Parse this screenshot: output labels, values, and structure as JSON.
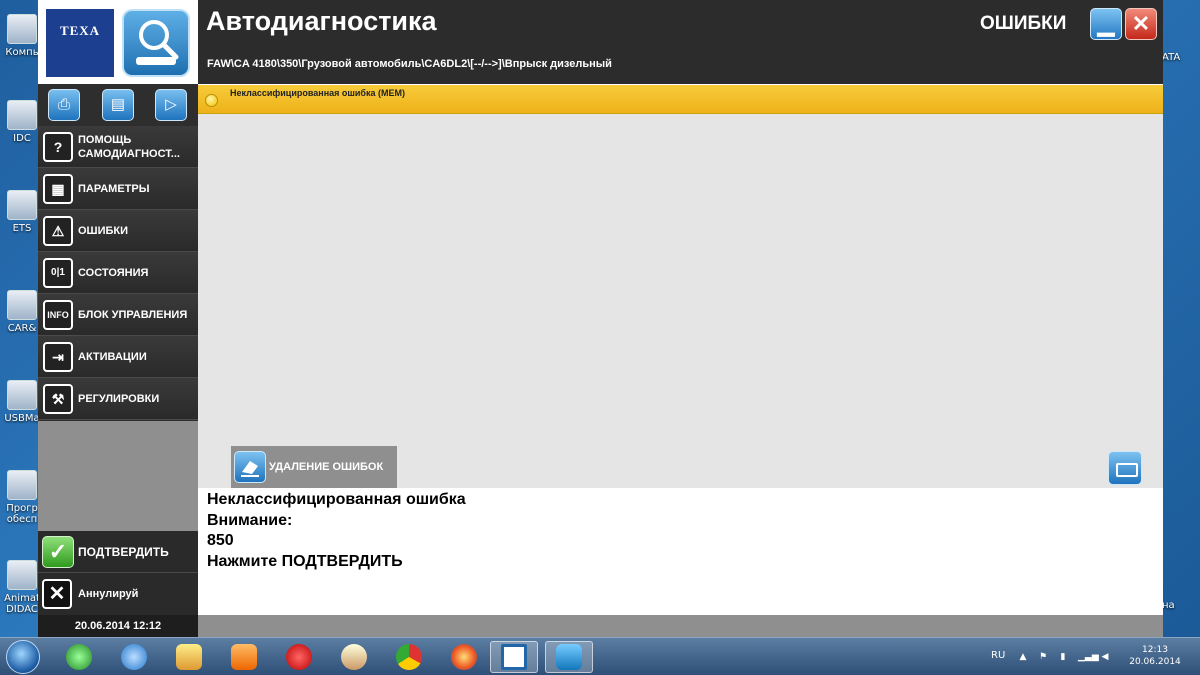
{
  "window": {
    "title": "Автодиагностика",
    "path": "FAW\\CA 4180\\350\\Грузовой автомобиль\\CA6DL2\\[--/-->]\\Впрыск дизельный",
    "section": "ОШИБКИ",
    "logo_text": "TEXA"
  },
  "menu": {
    "items": [
      {
        "label": "ПОМОЩЬ САМОДИАГНОСТ...",
        "icon": "?"
      },
      {
        "label": "ПАРАМЕТРЫ",
        "icon": "▦"
      },
      {
        "label": "ОШИБКИ",
        "icon": "⚠"
      },
      {
        "label": "СОСТОЯНИЯ",
        "icon": "0|1"
      },
      {
        "label": "БЛОК УПРАВЛЕНИЯ",
        "icon": "INFO"
      },
      {
        "label": "АКТИВАЦИИ",
        "icon": "⇥"
      },
      {
        "label": "РЕГУЛИРОВКИ",
        "icon": "⚒"
      }
    ],
    "confirm_label": "ПОДТВЕРДИТЬ",
    "cancel_label": "Аннулируй",
    "datetime": "20.06.2014  12:12"
  },
  "errors": {
    "row_text": "Неклассифицированная ошибка (MEM)",
    "delete_label": "УДАЛЕНИЕ ОШИБОК"
  },
  "message": {
    "line1": "Неклассифицированная ошибка",
    "line2": "Внимание:",
    "line3": "850",
    "line4": "Нажмите ПОДТВЕРДИТЬ"
  },
  "desktop": {
    "icons": [
      "Компь",
      "IDC",
      "ETS",
      "CAR&",
      "USBMa",
      "Прогр обесп",
      "Animat DIDAC"
    ],
    "right_labels": [
      "ATA",
      "на"
    ]
  },
  "taskbar": {
    "lang": "RU",
    "time": "12:13",
    "date": "20.06.2014"
  }
}
